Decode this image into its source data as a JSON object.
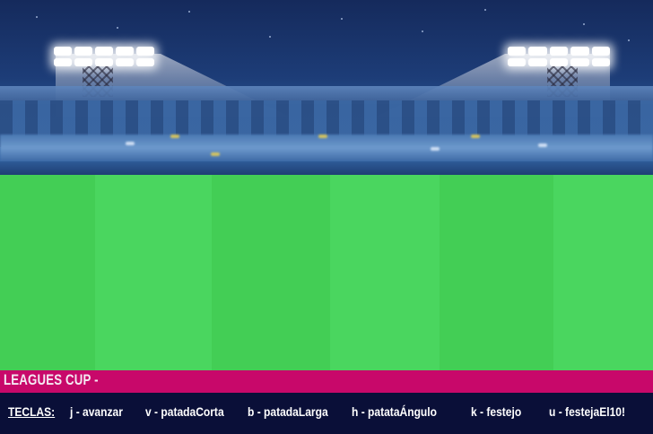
{
  "hud": {
    "title": "LEAGUES CUP -",
    "keys_label": "TECLAS:",
    "keys": [
      "j - avanzar",
      "v - patadaCorta",
      "b - patadaLarga",
      "h -  patataÁngulo",
      "k - festejo",
      "u - festejaEl10!"
    ]
  },
  "colors": {
    "title_bar": "#c8086a",
    "keys_bar": "#0a0f38",
    "grass_dark": "#43ce55",
    "grass_light": "#4ad65f"
  }
}
